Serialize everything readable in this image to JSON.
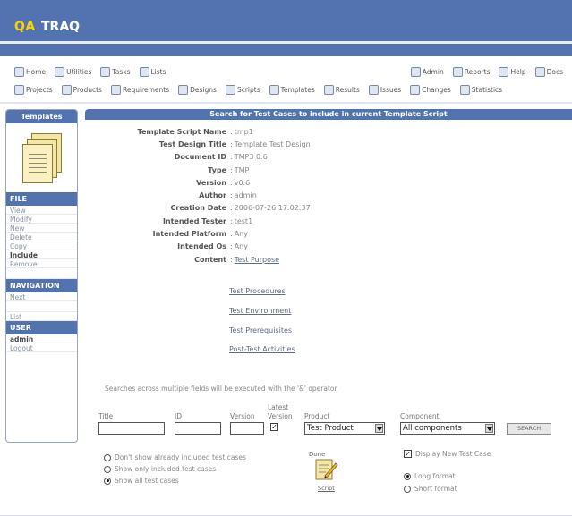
{
  "app": {
    "logo_a": "QA",
    "logo_b": "TRAQ"
  },
  "toolbar_top": {
    "left": [
      "Home",
      "Utilities",
      "Tasks",
      "Lists"
    ],
    "right": [
      "Admin",
      "Reports",
      "Help",
      "Docs"
    ]
  },
  "toolbar_second": [
    "Projects",
    "Products",
    "Requirements",
    "Designs",
    "Scripts",
    "Templates",
    "Results",
    "Issues",
    "Changes",
    "Statistics"
  ],
  "sidebar": {
    "title": "Templates",
    "file_header": "FILE",
    "file_items": [
      "View",
      "Modify",
      "New",
      "Delete",
      "Copy",
      "Include",
      "Remove"
    ],
    "active_file_item": "Include",
    "nav_header": "NAVIGATION",
    "nav_items": [
      "Next",
      "",
      "List"
    ],
    "user_header": "USER",
    "user_items": [
      "admin",
      "Logout"
    ]
  },
  "panel_title": "Search for Test Cases to include in current Template Script",
  "details": [
    {
      "label": "Template Script Name",
      "value": "tmp1"
    },
    {
      "label": "Test Design Title",
      "value": "Template Test Design"
    },
    {
      "label": "Document ID",
      "value": "TMP3 0.6"
    },
    {
      "label": "Type",
      "value": "TMP"
    },
    {
      "label": "Version",
      "value": "v0.6"
    },
    {
      "label": "Author",
      "value": "admin"
    },
    {
      "label": "Creation Date",
      "value": "2006-07-26 17:02:37"
    },
    {
      "label": "Intended Tester",
      "value": "test1"
    },
    {
      "label": "Intended Platform",
      "value": "Any"
    },
    {
      "label": "Intended Os",
      "value": "Any"
    },
    {
      "label": "Content",
      "value": "Test Purpose"
    }
  ],
  "content_links": [
    "Test Procedures",
    "Test Environment",
    "Test Prerequisites",
    "Post-Test Activities"
  ],
  "search_note": "Searches across multiple fields will be executed with the '&' operator",
  "search": {
    "title_label": "Title",
    "id_label": "ID",
    "version_label": "Version",
    "latest_version_label_1": "Latest",
    "latest_version_label_2": "Version",
    "latest_version_checked": true,
    "product_label": "Product",
    "product_value": "Test Product",
    "component_label": "Component",
    "component_value": "All components",
    "search_button": "SEARCH"
  },
  "filter_options": [
    {
      "label": "Don't show already included test cases",
      "checked": false
    },
    {
      "label": "Show only included test cases",
      "checked": false
    },
    {
      "label": "Show all test cases",
      "checked": true
    }
  ],
  "done_icon": {
    "label_top": "Done",
    "label_bottom": "Script"
  },
  "display_options": {
    "display_new_label": "Display New Test Case",
    "display_new_checked": true,
    "formats": [
      {
        "label": "Long format",
        "checked": true
      },
      {
        "label": "Short format",
        "checked": false
      }
    ]
  },
  "colors": {
    "header": "#5373b0",
    "logo_accent": "#fbd200",
    "panel_header": "#5373b0"
  }
}
